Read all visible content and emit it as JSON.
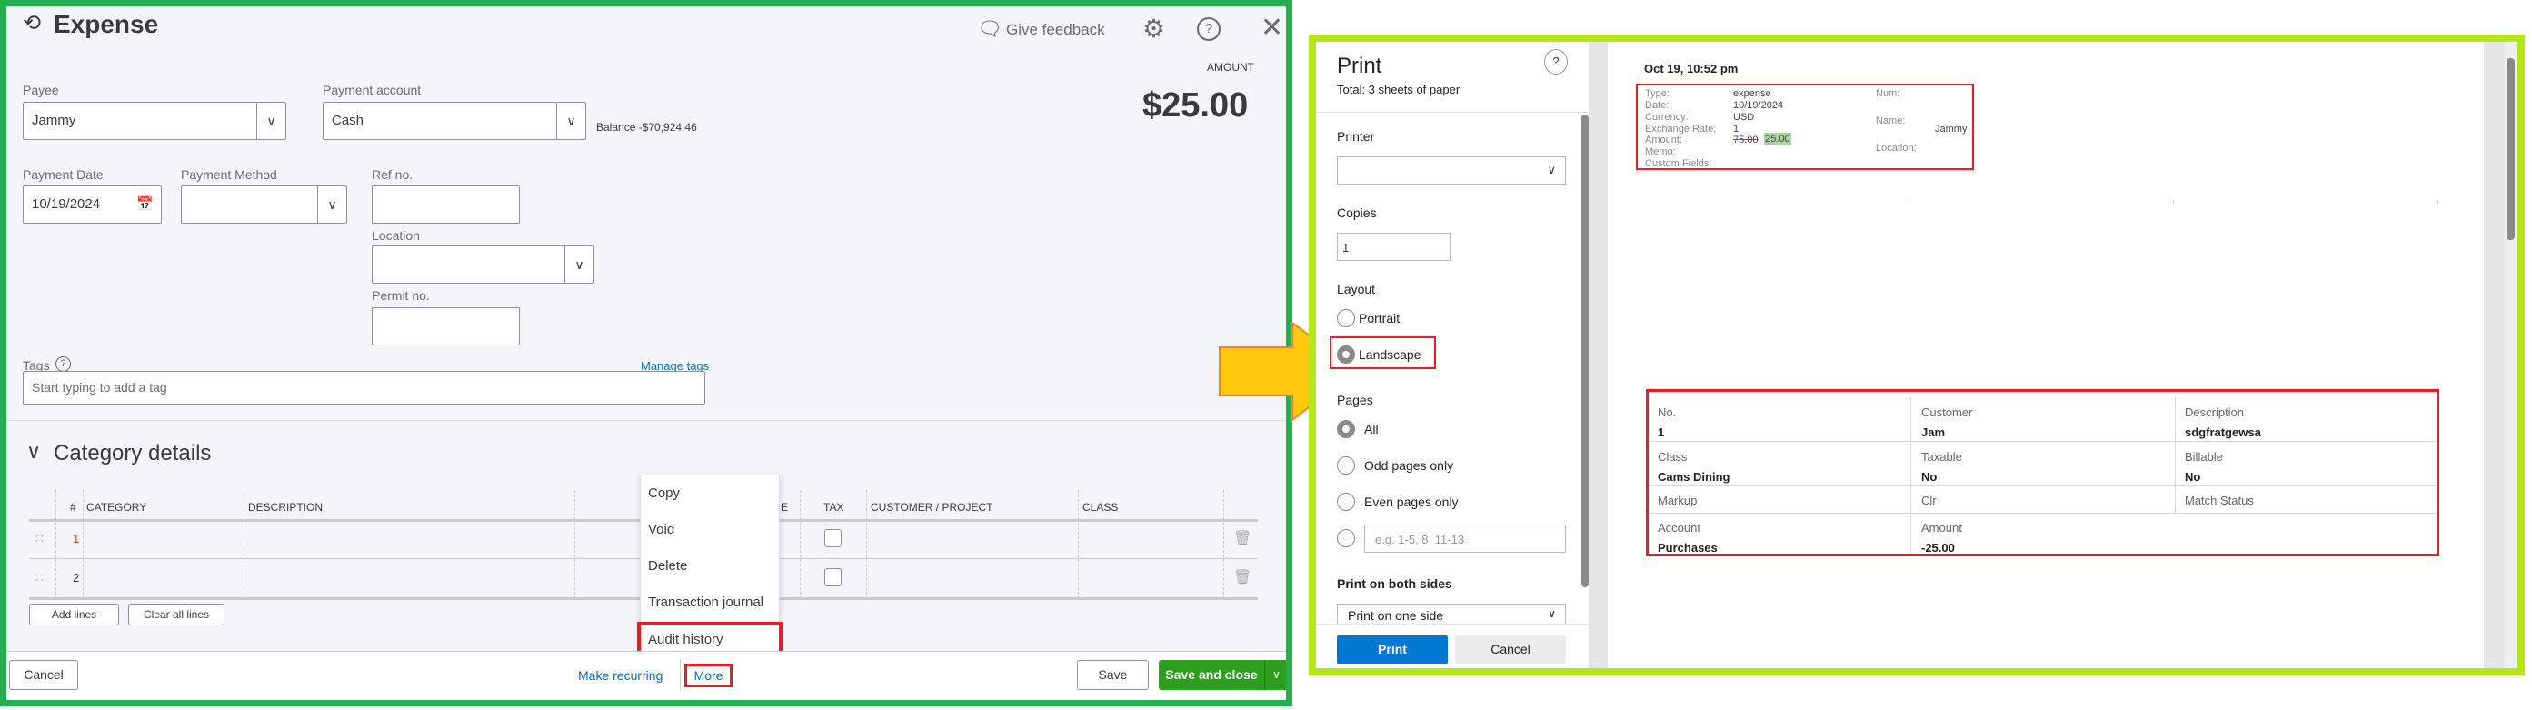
{
  "expense": {
    "title": "Expense",
    "give_feedback": "Give feedback",
    "amount_label": "AMOUNT",
    "amount_value": "$25.00",
    "payee": {
      "label": "Payee",
      "value": "Jammy"
    },
    "payment_account": {
      "label": "Payment account",
      "value": "Cash",
      "balance": "Balance -$70,924.46"
    },
    "payment_date": {
      "label": "Payment Date",
      "value": "10/19/2024"
    },
    "payment_method": {
      "label": "Payment Method",
      "value": ""
    },
    "ref_no": {
      "label": "Ref no.",
      "value": ""
    },
    "location": {
      "label": "Location",
      "value": ""
    },
    "permit_no": {
      "label": "Permit no.",
      "value": ""
    },
    "tags": {
      "label": "Tags",
      "manage": "Manage tags",
      "placeholder": "Start typing to add a tag"
    },
    "category_details": {
      "title": "Category details",
      "columns": [
        "#",
        "CATEGORY",
        "DESCRIPTION",
        "E",
        "TAX",
        "CUSTOMER / PROJECT",
        "CLASS"
      ],
      "rows": [
        "1",
        "2"
      ],
      "add_lines": "Add lines",
      "clear_all_lines": "Clear all lines"
    },
    "more_menu": [
      "Copy",
      "Void",
      "Delete",
      "Transaction journal",
      "Audit history"
    ],
    "footer": {
      "cancel": "Cancel",
      "make_recurring": "Make recurring",
      "more": "More",
      "save": "Save",
      "save_and_close": "Save and close"
    }
  },
  "print": {
    "title": "Print",
    "subtitle": "Total: 3 sheets of paper",
    "help": "?",
    "printer_label": "Printer",
    "printer_value": "",
    "copies_label": "Copies",
    "copies_value": "1",
    "layout_label": "Layout",
    "layout_options": [
      "Portrait",
      "Landscape"
    ],
    "layout_selected": "Landscape",
    "pages_label": "Pages",
    "pages_options": [
      "All",
      "Odd pages only",
      "Even pages only"
    ],
    "pages_selected": "All",
    "pages_custom_placeholder": "e.g. 1-5, 8, 11-13",
    "both_sides_label": "Print on both sides",
    "both_sides_value": "Print on one side",
    "print_button": "Print",
    "cancel_button": "Cancel",
    "preview": {
      "timestamp": "Oct 19, 10:52 pm",
      "info": {
        "type_label": "Type:",
        "type": "expense",
        "date_label": "Date:",
        "date": "10/19/2024",
        "currency_label": "Currency:",
        "currency": "USD",
        "exchange_label": "Exchange Rate:",
        "exchange": "1",
        "amount_label": "Amount:",
        "amount_old": "75.00",
        "amount_new": "25.00",
        "memo_label": "Memo:",
        "custom_label": "Custom Fields:",
        "num_label": "Num:",
        "name_label": "Name:",
        "name": "Jammy",
        "location_label": "Location:"
      },
      "detail": {
        "no_label": "No.",
        "no": "1",
        "customer_label": "Customer",
        "customer": "Jam",
        "description_label": "Description",
        "description": "sdgfratgewsa",
        "class_label": "Class",
        "class": "Cams Dining",
        "taxable_label": "Taxable",
        "taxable": "No",
        "billable_label": "Billable",
        "billable": "No",
        "markup_label": "Markup",
        "clr_label": "Clr",
        "match_label": "Match Status",
        "account_label": "Account",
        "account": "Purchases",
        "amount_label": "Amount",
        "amount": "-25.00"
      }
    }
  }
}
